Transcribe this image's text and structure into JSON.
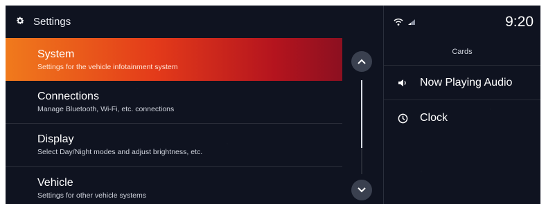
{
  "header": {
    "title": "Settings",
    "icon": "gear-icon"
  },
  "menu": {
    "items": [
      {
        "title": "System",
        "description": "Settings for the vehicle infotainment system",
        "active": true
      },
      {
        "title": "Connections",
        "description": "Manage Bluetooth, Wi-Fi, etc. connections",
        "active": false
      },
      {
        "title": "Display",
        "description": "Select Day/Night modes and adjust brightness, etc.",
        "active": false
      },
      {
        "title": "Vehicle",
        "description": "Settings for other vehicle systems",
        "active": false
      }
    ]
  },
  "scroll": {
    "position_fraction": 0.0,
    "visible_fraction": 0.72
  },
  "status": {
    "time": "9:20",
    "icons": [
      "wifi-icon",
      "phone-signal-icon"
    ]
  },
  "cards": {
    "header": "Cards",
    "items": [
      {
        "label": "Now Playing Audio",
        "icon": "speaker-icon"
      },
      {
        "label": "Clock",
        "icon": "clock-icon"
      }
    ]
  },
  "colors": {
    "active_gradient_start": "#f07a1c",
    "active_gradient_end": "#8c1020",
    "background": "#0f1320"
  }
}
